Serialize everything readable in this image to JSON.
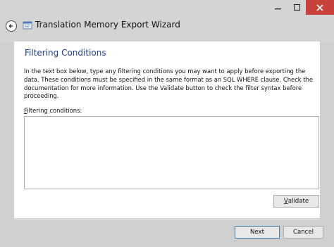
{
  "window": {
    "title": "Translation Memory Export Wizard"
  },
  "page": {
    "heading": "Filtering Conditions",
    "description": "In the text box below, type any filtering conditions you may want to apply before exporting the data. These conditions must be specified in the same format as an SQL WHERE clause. Check the documentation for more information. Use the Validate button to check the filter syntax before proceeding.",
    "field_label_first": "F",
    "field_label_rest": "iltering conditions:",
    "filter_value": ""
  },
  "buttons": {
    "validate_first": "V",
    "validate_rest": "alidate",
    "next": "Next",
    "cancel": "Cancel"
  },
  "colors": {
    "heading": "#1c3e9a",
    "close_button": "#c7423a",
    "window_chrome": "#d4d4d4"
  },
  "icons": [
    "back-arrow-icon",
    "app-icon",
    "minimize-icon",
    "maximize-icon",
    "close-icon"
  ]
}
